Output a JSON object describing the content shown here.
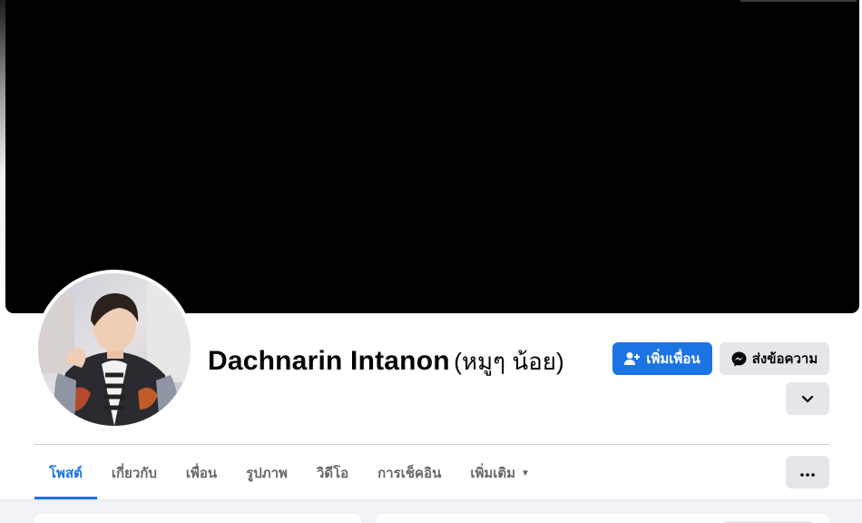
{
  "profile": {
    "name": "Dachnarin Intanon",
    "alternate_name": "(หมูๆ น้อย)"
  },
  "actions": {
    "add_friend_label": "เพิ่มเพื่อน",
    "message_label": "ส่งข้อความ"
  },
  "tabs": [
    {
      "label": "โพสต์",
      "active": true
    },
    {
      "label": "เกี่ยวกับ",
      "active": false
    },
    {
      "label": "เพื่อน",
      "active": false
    },
    {
      "label": "รูปภาพ",
      "active": false
    },
    {
      "label": "วิดีโอ",
      "active": false
    },
    {
      "label": "การเช็คอิน",
      "active": false
    },
    {
      "label": "เพิ่มเติม",
      "active": false
    }
  ],
  "icons": {
    "add_friend": "user-plus-icon",
    "message": "messenger-icon",
    "expand": "chevron-down-icon",
    "more": "more-dots-icon",
    "tab_more_caret": "caret-down-icon"
  },
  "colors": {
    "accent": "#1b74e4",
    "secondary_button": "#e4e6eb",
    "text_muted": "#65676b",
    "text_main": "#050505",
    "cover": "#000000",
    "background": "#f0f2f5"
  }
}
